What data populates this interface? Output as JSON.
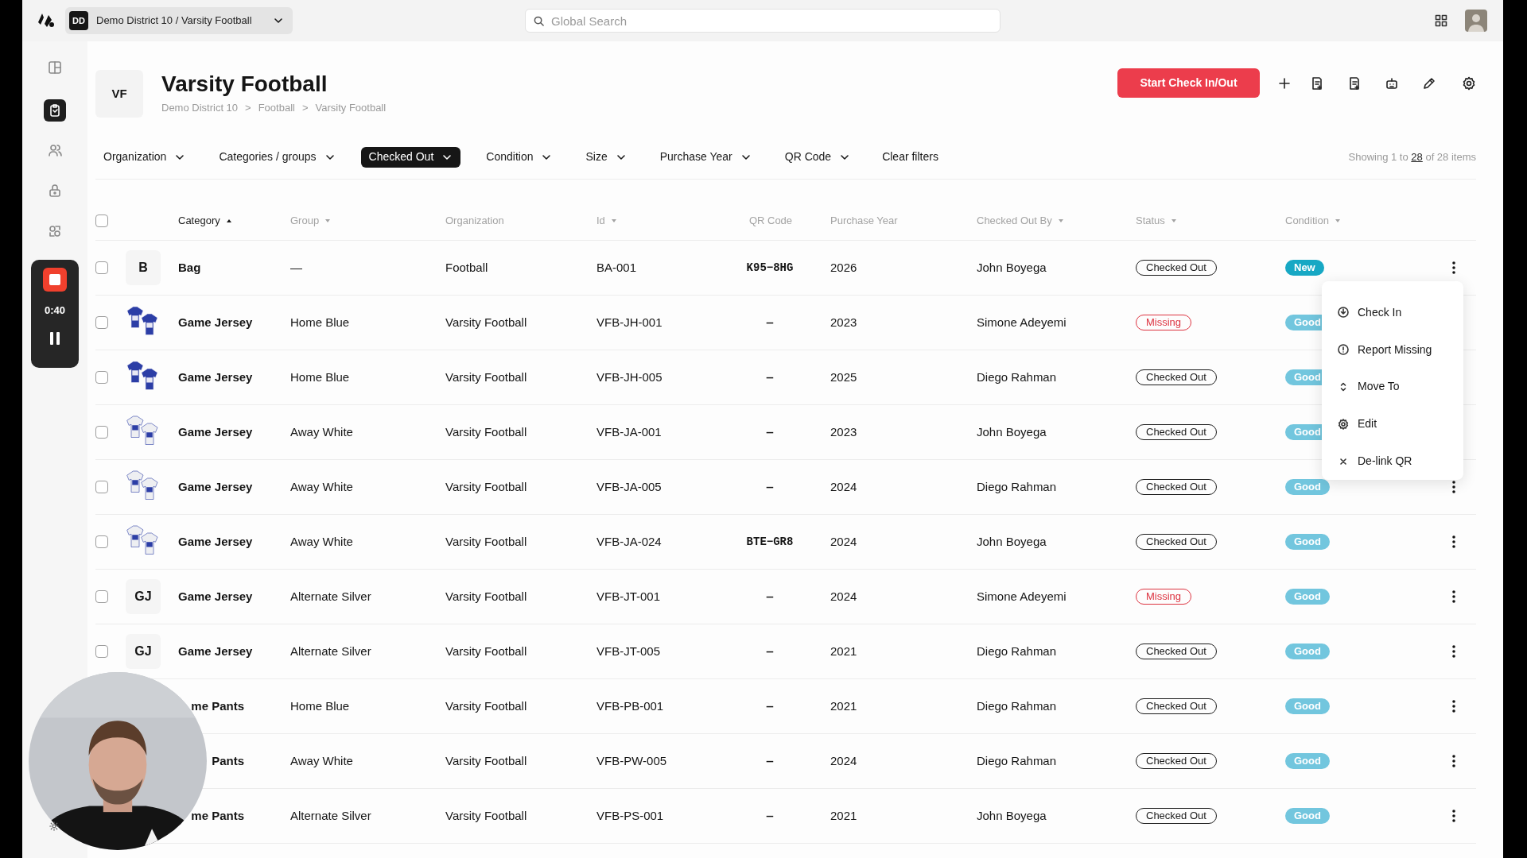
{
  "top_bar": {
    "workspace_initials": "DD",
    "workspace": "Demo District 10 / Varsity Football",
    "search": {
      "placeholder": "Global Search"
    }
  },
  "sidebar": {
    "items": [
      {
        "selected": false
      },
      {
        "selected": true
      },
      {
        "selected": false
      },
      {
        "selected": false
      },
      {
        "selected": false
      }
    ]
  },
  "recorder": {
    "time": "0:40"
  },
  "header": {
    "initials": "VF",
    "title": "Varsity Football",
    "breadcrumbs": [
      "Demo District 10",
      "Football",
      "Varsity Football"
    ],
    "separator": ">",
    "primary_button": "Start Check In/Out"
  },
  "filters": [
    {
      "label": "Organization",
      "selected": false
    },
    {
      "label": "Categories / groups",
      "selected": false
    },
    {
      "label": "Checked Out",
      "selected": true
    },
    {
      "label": "Condition",
      "selected": false
    },
    {
      "label": "Size",
      "selected": false
    },
    {
      "label": "Purchase Year",
      "selected": false
    },
    {
      "label": "QR Code",
      "selected": false
    }
  ],
  "clear_filters": "Clear filters",
  "result_count": {
    "before": "Showing 1 to",
    "link": "28",
    "after": "of 28 items"
  },
  "table": {
    "select_all": {
      "checked": false
    },
    "columns": [
      {
        "label": "Category",
        "sort_ascending": true,
        "selected": true
      },
      {
        "label": "Group",
        "sort_ascending": false,
        "selected": false
      },
      {
        "label": "Organization",
        "selected": false
      },
      {
        "label": "Id",
        "sort_ascending": false,
        "selected": false
      },
      {
        "label": "QR Code",
        "selected": false
      },
      {
        "label": "Purchase Year",
        "selected": false
      },
      {
        "label": "Checked Out By",
        "sort_ascending": false,
        "selected": false
      },
      {
        "label": "Status",
        "sort_ascending": false,
        "selected": false
      },
      {
        "label": "Condition",
        "sort_ascending": false,
        "selected": false
      }
    ],
    "rows": [
      {
        "checked": false,
        "thumb": {
          "kind": "letters",
          "text": "B"
        },
        "category": "Bag",
        "group": "—",
        "organization": "Football",
        "id": "BA-001",
        "qr_code": "K95−8HG",
        "purchase_year": "2026",
        "checked_out_by": "John Boyega",
        "status": {
          "kind": "out",
          "label": "Checked Out"
        },
        "condition": {
          "label": "New",
          "color": "#17a8c4"
        },
        "actions_visible": true
      },
      {
        "checked": false,
        "thumb": {
          "kind": "blue-jersey"
        },
        "category": "Game Jersey",
        "group": "Home Blue",
        "organization": "Varsity Football",
        "id": "VFB-JH-001",
        "qr_code": "—",
        "purchase_year": "2023",
        "checked_out_by": "Simone Adeyemi",
        "status": {
          "kind": "missing",
          "label": "Missing"
        },
        "condition": {
          "label": "Good",
          "color": "#72c6de"
        },
        "actions_visible": false
      },
      {
        "checked": false,
        "thumb": {
          "kind": "blue-jersey"
        },
        "category": "Game Jersey",
        "group": "Home Blue",
        "organization": "Varsity Football",
        "id": "VFB-JH-005",
        "qr_code": "—",
        "purchase_year": "2025",
        "checked_out_by": "Diego Rahman",
        "status": {
          "kind": "out",
          "label": "Checked Out"
        },
        "condition": {
          "label": "Good",
          "color": "#72c6de"
        },
        "actions_visible": false
      },
      {
        "checked": false,
        "thumb": {
          "kind": "white-jersey"
        },
        "category": "Game Jersey",
        "group": "Away White",
        "organization": "Varsity Football",
        "id": "VFB-JA-001",
        "qr_code": "—",
        "purchase_year": "2023",
        "checked_out_by": "John Boyega",
        "status": {
          "kind": "out",
          "label": "Checked Out"
        },
        "condition": {
          "label": "Good",
          "color": "#72c6de"
        },
        "actions_visible": false
      },
      {
        "checked": false,
        "thumb": {
          "kind": "white-jersey"
        },
        "category": "Game Jersey",
        "group": "Away White",
        "organization": "Varsity Football",
        "id": "VFB-JA-005",
        "qr_code": "—",
        "purchase_year": "2024",
        "checked_out_by": "Diego Rahman",
        "status": {
          "kind": "out",
          "label": "Checked Out"
        },
        "condition": {
          "label": "Good",
          "color": "#72c6de"
        },
        "actions_visible": true
      },
      {
        "checked": false,
        "thumb": {
          "kind": "white-jersey"
        },
        "category": "Game Jersey",
        "group": "Away White",
        "organization": "Varsity Football",
        "id": "VFB-JA-024",
        "qr_code": "BTE−GR8",
        "purchase_year": "2024",
        "checked_out_by": "John Boyega",
        "status": {
          "kind": "out",
          "label": "Checked Out"
        },
        "condition": {
          "label": "Good",
          "color": "#72c6de"
        },
        "actions_visible": true
      },
      {
        "checked": false,
        "thumb": {
          "kind": "letters",
          "text": "GJ"
        },
        "category": "Game Jersey",
        "group": "Alternate Silver",
        "organization": "Varsity Football",
        "id": "VFB-JT-001",
        "qr_code": "—",
        "purchase_year": "2024",
        "checked_out_by": "Simone Adeyemi",
        "status": {
          "kind": "missing",
          "label": "Missing"
        },
        "condition": {
          "label": "Good",
          "color": "#72c6de"
        },
        "actions_visible": true
      },
      {
        "checked": false,
        "thumb": {
          "kind": "letters",
          "text": "GJ"
        },
        "category": "Game Jersey",
        "group": "Alternate Silver",
        "organization": "Varsity Football",
        "id": "VFB-JT-005",
        "qr_code": "—",
        "purchase_year": "2021",
        "checked_out_by": "Diego Rahman",
        "status": {
          "kind": "out",
          "label": "Checked Out"
        },
        "condition": {
          "label": "Good",
          "color": "#72c6de"
        },
        "actions_visible": true
      },
      {
        "thumb": {
          "kind": "covered"
        },
        "category": "me Pants",
        "group": "Home Blue",
        "organization": "Varsity Football",
        "id": "VFB-PB-001",
        "qr_code": "—",
        "purchase_year": "2021",
        "checked_out_by": "Diego Rahman",
        "status": {
          "kind": "out",
          "label": "Checked Out"
        },
        "condition": {
          "label": "Good",
          "color": "#72c6de"
        },
        "actions_visible": true
      },
      {
        "thumb": {
          "kind": "covered"
        },
        "category": "Pants",
        "group": "Away White",
        "organization": "Varsity Football",
        "id": "VFB-PW-005",
        "qr_code": "—",
        "purchase_year": "2024",
        "checked_out_by": "Diego Rahman",
        "status": {
          "kind": "out",
          "label": "Checked Out"
        },
        "condition": {
          "label": "Good",
          "color": "#72c6de"
        },
        "actions_visible": true
      },
      {
        "thumb": {
          "kind": "covered"
        },
        "category": "me Pants",
        "group": "Alternate Silver",
        "organization": "Varsity Football",
        "id": "VFB-PS-001",
        "qr_code": "—",
        "purchase_year": "2021",
        "checked_out_by": "John Boyega",
        "status": {
          "kind": "out",
          "label": "Checked Out"
        },
        "condition": {
          "label": "Good",
          "color": "#72c6de"
        },
        "actions_visible": true
      }
    ]
  },
  "row_menu": {
    "items": [
      {
        "kind": "check-in",
        "label": "Check In"
      },
      {
        "kind": "report",
        "label": "Report Missing"
      },
      {
        "kind": "move",
        "label": "Move To"
      },
      {
        "kind": "edit",
        "label": "Edit"
      },
      {
        "kind": "delink",
        "label": "De-link QR"
      }
    ]
  }
}
